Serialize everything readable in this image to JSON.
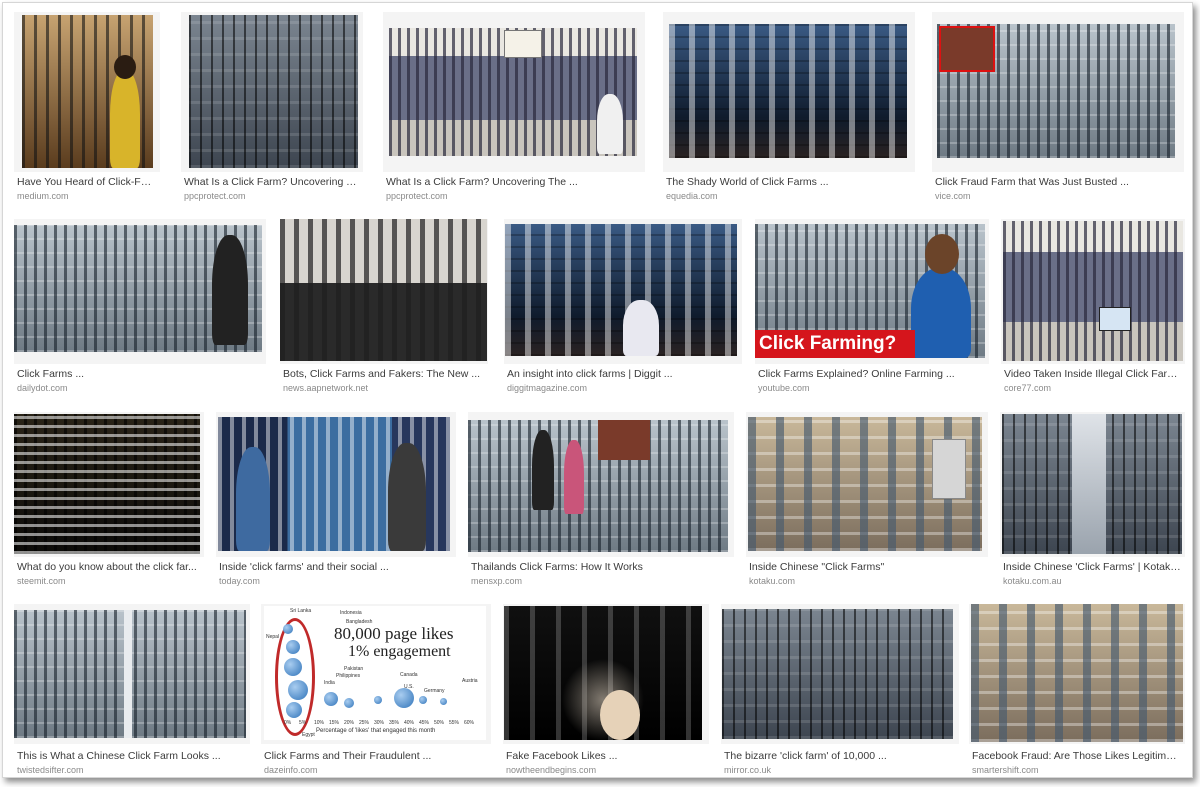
{
  "results": [
    {
      "title": "Have You Heard of Click-Far...",
      "source": "medium.com"
    },
    {
      "title": "What Is a Click Farm? Uncovering Th...",
      "source": "ppcprotect.com"
    },
    {
      "title": "What Is a Click Farm? Uncovering The ...",
      "source": "ppcprotect.com"
    },
    {
      "title": "The Shady World of Click Farms ...",
      "source": "equedia.com"
    },
    {
      "title": "Click Fraud Farm that Was Just Busted ...",
      "source": "vice.com"
    },
    {
      "title": "Click Farms ...",
      "source": "dailydot.com"
    },
    {
      "title": "Bots, Click Farms and Fakers: The New ...",
      "source": "news.aapnetwork.net"
    },
    {
      "title": "An insight into click farms | Diggit ...",
      "source": "diggitmagazine.com"
    },
    {
      "title": "Click Farms Explained? Online Farming ...",
      "source": "youtube.com"
    },
    {
      "title": "Video Taken Inside Illegal Click Farm...",
      "source": "core77.com"
    },
    {
      "title": "What do you know about the click far...",
      "source": "steemit.com"
    },
    {
      "title": "Inside 'click farms' and their social ...",
      "source": "today.com"
    },
    {
      "title": "Thailands Click Farms: How It Works",
      "source": "mensxp.com"
    },
    {
      "title": "Inside Chinese \"Click Farms\"",
      "source": "kotaku.com"
    },
    {
      "title": "Inside Chinese 'Click Farms' | Kotaku ...",
      "source": "kotaku.com.au"
    },
    {
      "title": "This is What a Chinese Click Farm Looks ...",
      "source": "twistedsifter.com"
    },
    {
      "title": "Click Farms and Their Fraudulent ...",
      "source": "dazeinfo.com"
    },
    {
      "title": "Fake Facebook Likes ...",
      "source": "nowtheendbegins.com"
    },
    {
      "title": "The bizarre 'click farm' of 10,000 ...",
      "source": "mirror.co.uk"
    },
    {
      "title": "Facebook Fraud: Are Those Likes Legitimate?",
      "source": "smartershift.com"
    }
  ],
  "overlays": {
    "youtube_banner": "Click Farming?",
    "chart_headline": "80,000 page likes",
    "chart_subhead": "1% engagement",
    "chart_caption": "Percentage of 'likes' that engaged this month",
    "chart_countries": [
      "Sri Lanka",
      "Indonesia",
      "Bangladesh",
      "Nepal",
      "Pakistan",
      "Philippines",
      "India",
      "Canada",
      "U.S.",
      "Germany",
      "Austria",
      "Egypt"
    ],
    "chart_ticks": [
      "0%",
      "5%",
      "10%",
      "15%",
      "20%",
      "25%",
      "30%",
      "35%",
      "40%",
      "45%",
      "50%",
      "55%",
      "60%"
    ]
  },
  "colors": {
    "title_text": "#3b3b3b",
    "source_text": "#8a8a8a",
    "youtube_red": "#d5151c",
    "chart_ring": "#c02a2a"
  }
}
